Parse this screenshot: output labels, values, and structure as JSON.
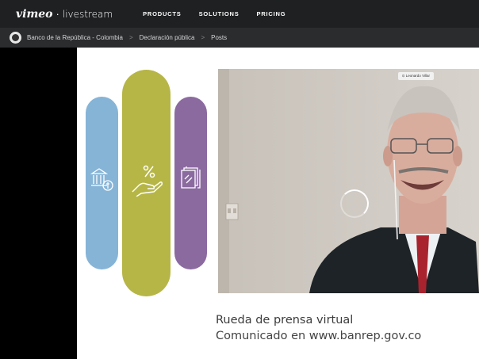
{
  "topbar": {
    "logo": "vimeo",
    "separator": "·",
    "product": "livestream",
    "nav": [
      "PRODUCTS",
      "SOLUTIONS",
      "PRICING"
    ]
  },
  "breadcrumb": {
    "items": [
      "Banco de la República - Colombia",
      "Declaración pública",
      "Posts"
    ],
    "separator": ">"
  },
  "slide": {
    "video": {
      "participant_name": "Leonardo Villar",
      "state": "loading"
    },
    "caption": {
      "line1": "Rueda de prensa virtual",
      "line2": "Comunicado en www.banrep.gov.co"
    },
    "pills": [
      {
        "color": "#86b4d7",
        "icon": "bank-icon"
      },
      {
        "color": "#b6b646",
        "icon": "hand-percent-icon"
      },
      {
        "color": "#8b6aa0",
        "icon": "documents-icon"
      }
    ]
  }
}
